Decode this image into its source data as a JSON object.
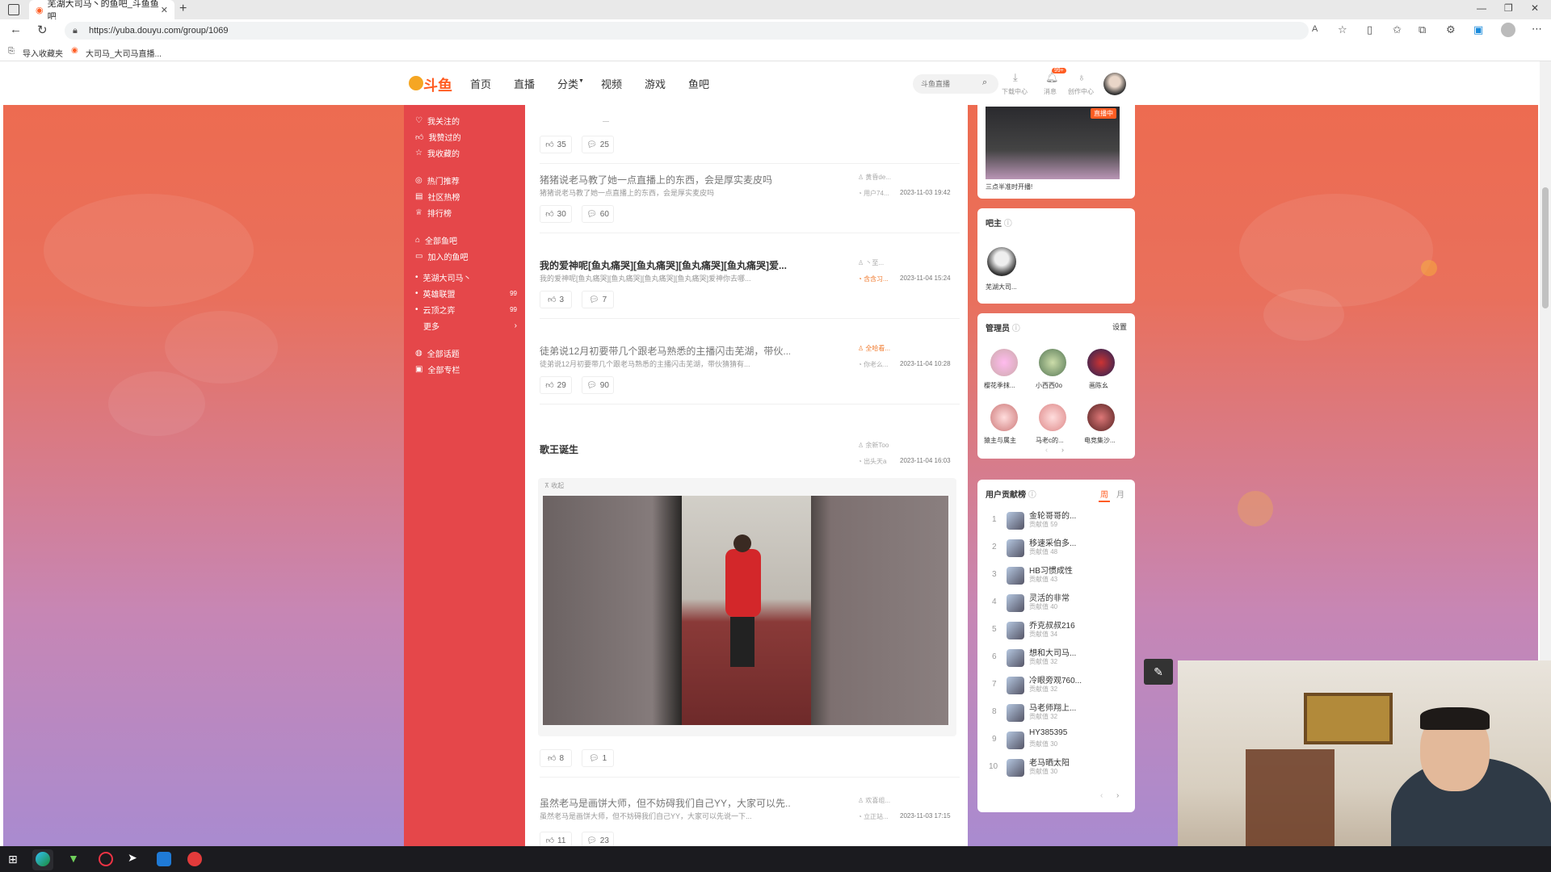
{
  "browser": {
    "tab_title": "芜湖大司马丶的鱼吧_斗鱼鱼吧",
    "url": "https://yuba.douyu.com/group/1069",
    "favorites": [
      "导入收藏夹",
      "大司马_大司马直播..."
    ]
  },
  "topnav": {
    "logo": "斗鱼",
    "links": [
      "首页",
      "直播",
      "分类",
      "视频",
      "游戏",
      "鱼吧"
    ],
    "search_placeholder": "斗鱼直播",
    "icons": [
      {
        "label": "下载中心",
        "badge": ""
      },
      {
        "label": "消息",
        "badge": "99+"
      },
      {
        "label": "创作中心",
        "badge": ""
      }
    ]
  },
  "sidebar": {
    "group1": [
      "我关注的",
      "我赞过的",
      "我收藏的"
    ],
    "group2": [
      "热门推荐",
      "社区热榜",
      "排行榜"
    ],
    "group3": [
      "全部鱼吧",
      "加入的鱼吧"
    ],
    "joined": [
      {
        "name": "芜湖大司马丶",
        "count": ""
      },
      {
        "name": "英雄联盟",
        "count": "99"
      },
      {
        "name": "云顶之弈",
        "count": "99"
      },
      {
        "name": "更多",
        "count": "›"
      }
    ],
    "group4": [
      "全部话题",
      "全部专栏"
    ]
  },
  "posts": [
    {
      "title": "",
      "excerpt": "",
      "likes": "35",
      "comments": "25",
      "author": "",
      "user": "",
      "date": ""
    },
    {
      "title": "猪猪说老马教了她一点直播上的东西，会是厚实麦皮吗",
      "excerpt": "猪猪说老马教了她一点直播上的东西，会是厚实麦皮吗",
      "likes": "30",
      "comments": "60",
      "author": "黄昏de...",
      "user": "用户74...",
      "date": "2023-11-03 19:42"
    },
    {
      "title": "我的爱神呢[鱼丸痛哭][鱼丸痛哭][鱼丸痛哭][鱼丸痛哭]爱...",
      "excerpt": "我的爱神呢[鱼丸痛哭][鱼丸痛哭][鱼丸痛哭][鱼丸痛哭]爱神你去哪...",
      "likes": "3",
      "comments": "7",
      "author": "丶至...",
      "user": "含含习...",
      "date": "2023-11-04 15:24"
    },
    {
      "title": "徒弟说12月初要带几个跟老马熟悉的主播闪击芜湖，带伙...",
      "excerpt": "徒弟说12月初要带几个跟老马熟悉的主播闪击芜湖，带伙猜猜有...",
      "likes": "29",
      "comments": "90",
      "author": "全哈看...",
      "user": "你老么...",
      "date": "2023-11-04 10:28"
    },
    {
      "title": "歌王诞生",
      "excerpt": "",
      "likes": "8",
      "comments": "1",
      "author": "余新Too",
      "user": "出头天a",
      "date": "2023-11-04 16:03",
      "image_caption": "收起"
    },
    {
      "title": "虽然老马是画饼大师，但不妨碍我们自己YY，大家可以先...",
      "excerpt": "虽然老马是画饼大师，但不妨碍我们自己YY，大家可以先说一下...",
      "likes": "11",
      "comments": "23",
      "author": "欢喜组...",
      "user": "立正站...",
      "date": "2023-11-03 17:15"
    }
  ],
  "right": {
    "live_caption": "三点半准时开播!",
    "live_badge": "直播中",
    "owner_title": "吧主",
    "owner_name": "芜湖大司...",
    "admins_title": "管理员",
    "admins_settings": "设置",
    "admins": [
      "樱花季抹...",
      "小西西0o",
      "画陈幺",
      "猿主与属主",
      "马老c的...",
      "电竞集沙..."
    ],
    "rank_title": "用户贡献榜",
    "rank_tabs": [
      "周",
      "月"
    ],
    "rank": [
      {
        "n": "1",
        "name": "金轮哥哥的...",
        "score": "贡献值 59"
      },
      {
        "n": "2",
        "name": "移速采伯多...",
        "score": "贡献值 48"
      },
      {
        "n": "3",
        "name": "HB习惯成性",
        "score": "贡献值 43"
      },
      {
        "n": "4",
        "name": "灵活的非常",
        "score": "贡献值 40"
      },
      {
        "n": "5",
        "name": "乔克叔叔216",
        "score": "贡献值 34"
      },
      {
        "n": "6",
        "name": "想和大司马...",
        "score": "贡献值 32"
      },
      {
        "n": "7",
        "name": "冷眼旁观760...",
        "score": "贡献值 32"
      },
      {
        "n": "8",
        "name": "马老师翔上...",
        "score": "贡献值 32"
      },
      {
        "n": "9",
        "name": "HY385395",
        "score": "贡献值 30"
      },
      {
        "n": "10",
        "name": "老马晒太阳",
        "score": "贡献值 30"
      }
    ]
  },
  "colors": {
    "brand": "#ff5d23",
    "sidebar": "#e5474a",
    "accent_orange": "#f07b2f"
  }
}
